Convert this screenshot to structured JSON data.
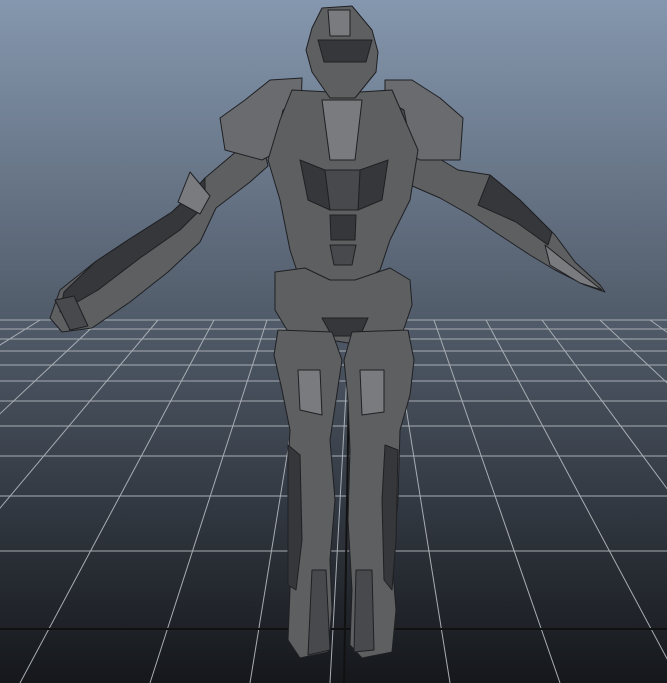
{
  "viewport": {
    "gradient_top": "#8597AE",
    "gradient_bottom": "#15171B",
    "grid_color": "#A8ADB3",
    "grid_axis_color": "#111111",
    "model_base_color": "#5E5F61",
    "model_shadow_color": "#36373A",
    "model_highlight_color": "#7A7B7E",
    "model_edge_color": "#1F2023"
  }
}
